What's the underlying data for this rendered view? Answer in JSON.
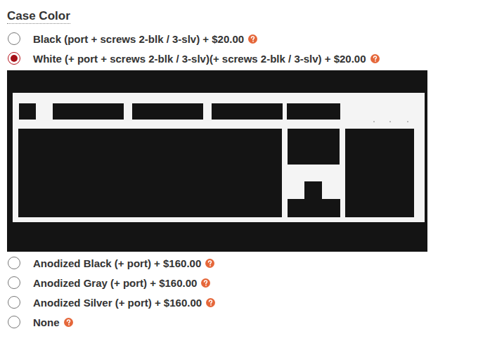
{
  "section": {
    "title": "Case Color"
  },
  "options": [
    {
      "label": "Black (port + screws 2-blk / 3-slv) + $20.00",
      "selected": false
    },
    {
      "label": "White (+ port + screws 2-blk / 3-slv)(+ screws 2-blk / 3-slv) + $20.00",
      "selected": true
    },
    {
      "label": "Anodized Black (+ port) + $160.00",
      "selected": false
    },
    {
      "label": "Anodized Gray (+ port) + $160.00",
      "selected": false
    },
    {
      "label": "Anodized Silver (+ port) + $160.00",
      "selected": false
    },
    {
      "label": "None",
      "selected": false
    }
  ],
  "preview": {
    "shown": true
  }
}
